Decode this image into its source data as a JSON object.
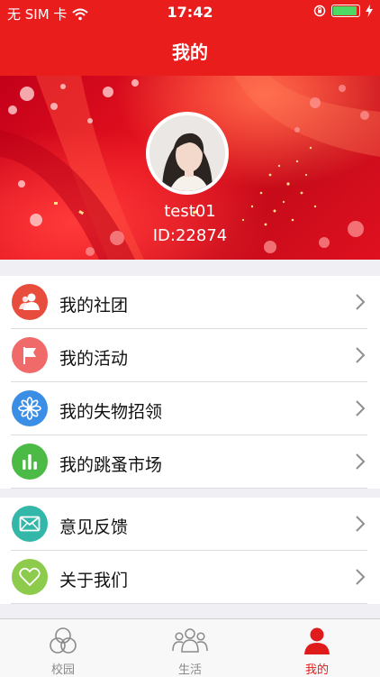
{
  "status_bar": {
    "carrier": "无 SIM 卡",
    "time": "17:42"
  },
  "nav": {
    "title": "我的"
  },
  "profile": {
    "username": "test01",
    "user_id": "ID:22874"
  },
  "menu_group_1": [
    {
      "label": "我的社团",
      "icon": "people-icon",
      "color": "#e74c3c"
    },
    {
      "label": "我的活动",
      "icon": "flag-icon",
      "color": "#f06a6a"
    },
    {
      "label": "我的失物招领",
      "icon": "flower-icon",
      "color": "#3a8ee6"
    },
    {
      "label": "我的跳蚤市场",
      "icon": "bars-icon",
      "color": "#4cbb45"
    }
  ],
  "menu_group_2": [
    {
      "label": "意见反馈",
      "icon": "mail-icon",
      "color": "#32b7a8"
    },
    {
      "label": "关于我们",
      "icon": "heart-icon",
      "color": "#8ccb4c"
    }
  ],
  "tabbar": [
    {
      "label": "校园",
      "icon": "rings-icon",
      "active": false
    },
    {
      "label": "生活",
      "icon": "group-icon",
      "active": false
    },
    {
      "label": "我的",
      "icon": "person-icon",
      "active": true
    }
  ],
  "colors": {
    "primary": "#ea1d1d",
    "active_tab": "#e01b1b"
  }
}
